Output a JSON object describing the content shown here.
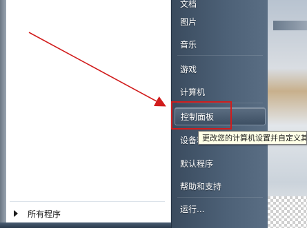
{
  "start_menu": {
    "right_items": [
      {
        "label": "文档"
      },
      {
        "label": "图片"
      },
      {
        "label": "音乐"
      },
      {
        "label": "游戏"
      },
      {
        "label": "计算机"
      },
      {
        "label": "控制面板"
      },
      {
        "label": "设备和打印机"
      },
      {
        "label": "默认程序"
      },
      {
        "label": "帮助和支持"
      },
      {
        "label": "运行..."
      }
    ],
    "all_programs_label": "所有程序"
  },
  "tooltip": {
    "text": "更改您的计算机设置并自定义其功能。"
  },
  "colors": {
    "annotation_red": "#d11c1c",
    "tooltip_bg": "#ffffe6"
  }
}
